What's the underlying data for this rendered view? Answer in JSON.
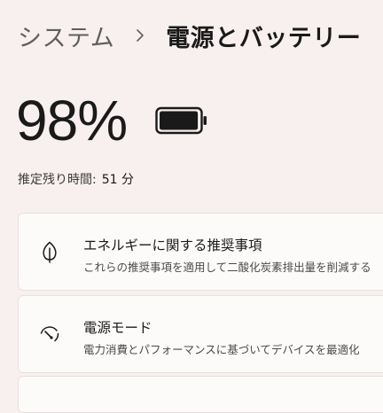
{
  "breadcrumb": {
    "parent": "システム",
    "separator_icon": "chevron-right-icon",
    "current": "電源とバッテリー"
  },
  "battery": {
    "percent_text": "98%",
    "level": 0.98,
    "icon": "battery-icon"
  },
  "remaining": {
    "label": "推定残り時間:",
    "value": "51 分"
  },
  "cards": [
    {
      "icon": "leaf-icon",
      "title": "エネルギーに関する推奨事項",
      "subtitle": "これらの推奨事項を適用して二酸化炭素排出量を削減する"
    },
    {
      "icon": "power-mode-gauge-icon",
      "title": "電源モード",
      "subtitle": "電力消費とパフォーマンスに基づいてデバイスを最適化"
    }
  ],
  "colors": {
    "background": "#f7f0ee",
    "card_background": "#fdfbfa",
    "card_border": "#e6e0de",
    "text_primary": "#1a1a1a",
    "text_secondary": "#5f5f5f"
  }
}
